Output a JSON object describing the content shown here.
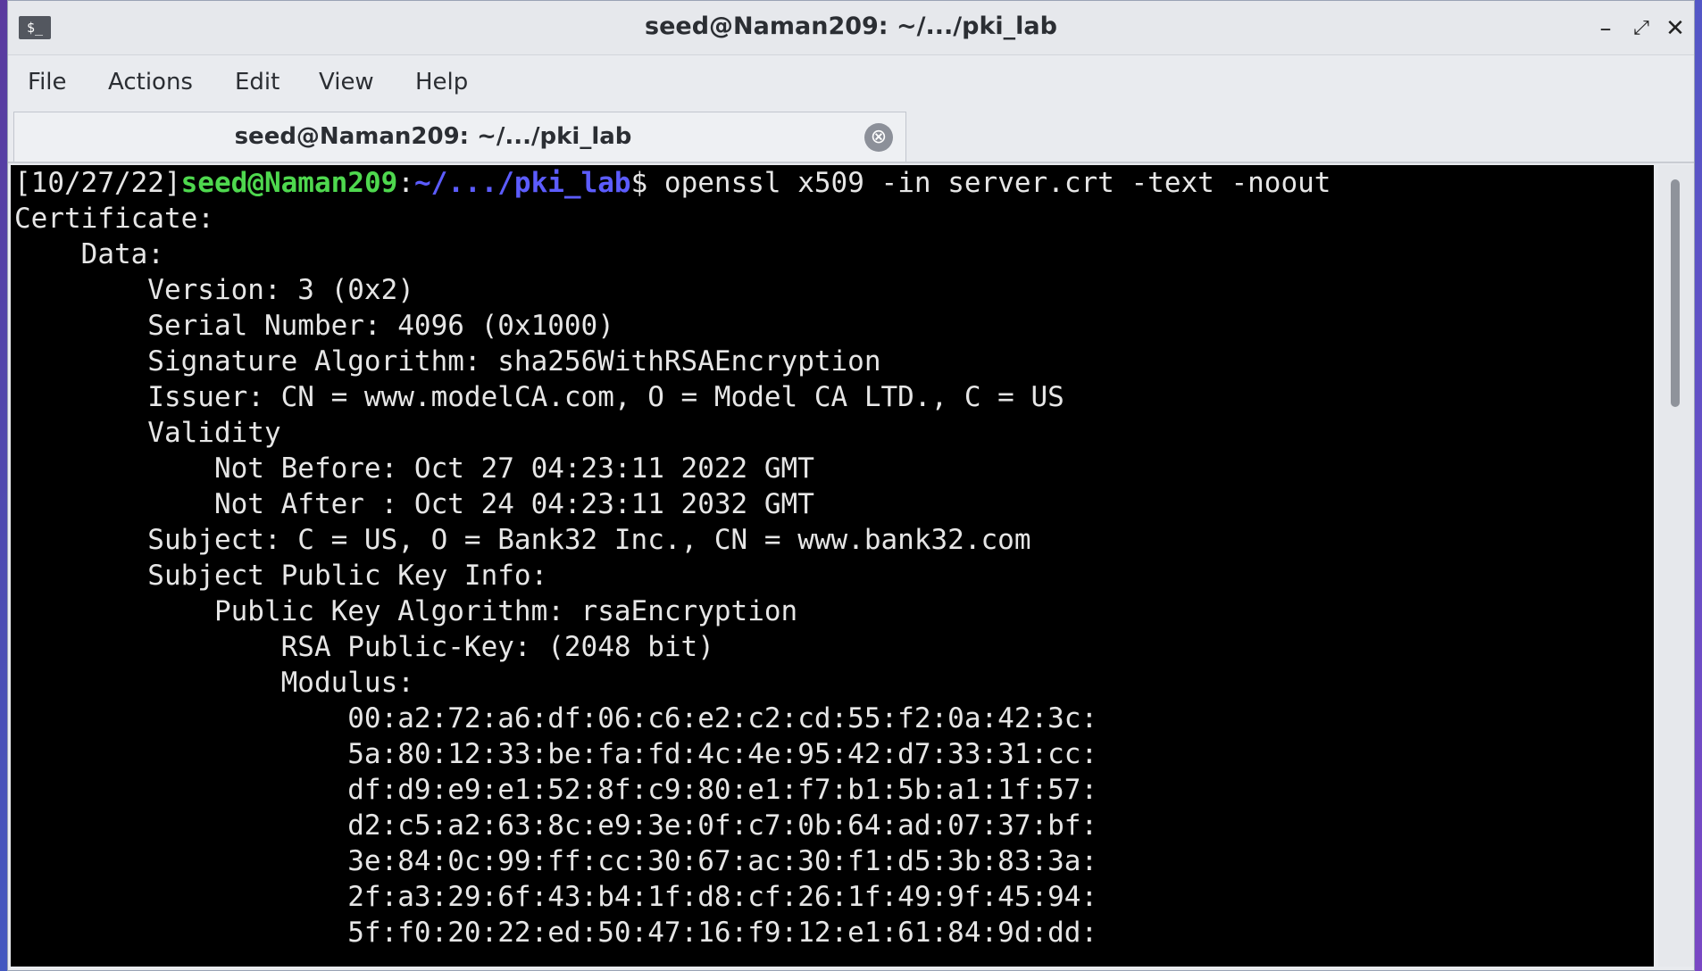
{
  "window": {
    "title": "seed@Naman209: ~/.../pki_lab",
    "icon_label": "$_",
    "controls": {
      "minimize": "–",
      "maximize": "⤢",
      "close": "✕"
    }
  },
  "menubar": {
    "items": [
      "File",
      "Actions",
      "Edit",
      "View",
      "Help"
    ]
  },
  "tabs": [
    {
      "label": "seed@Naman209: ~/.../pki_lab",
      "close_icon": "⊗"
    }
  ],
  "terminal": {
    "prompt": {
      "date": "[10/27/22]",
      "user_host": "seed@Naman209",
      "colon": ":",
      "path": "~/.../pki_lab",
      "symbol": "$ ",
      "command": "openssl x509 -in server.crt -text -noout"
    },
    "output_lines": [
      "Certificate:",
      "    Data:",
      "        Version: 3 (0x2)",
      "        Serial Number: 4096 (0x1000)",
      "        Signature Algorithm: sha256WithRSAEncryption",
      "        Issuer: CN = www.modelCA.com, O = Model CA LTD., C = US",
      "        Validity",
      "            Not Before: Oct 27 04:23:11 2022 GMT",
      "            Not After : Oct 24 04:23:11 2032 GMT",
      "        Subject: C = US, O = Bank32 Inc., CN = www.bank32.com",
      "        Subject Public Key Info:",
      "            Public Key Algorithm: rsaEncryption",
      "                RSA Public-Key: (2048 bit)",
      "                Modulus:",
      "                    00:a2:72:a6:df:06:c6:e2:c2:cd:55:f2:0a:42:3c:",
      "                    5a:80:12:33:be:fa:fd:4c:4e:95:42:d7:33:31:cc:",
      "                    df:d9:e9:e1:52:8f:c9:80:e1:f7:b1:5b:a1:1f:57:",
      "                    d2:c5:a2:63:8c:e9:3e:0f:c7:0b:64:ad:07:37:bf:",
      "                    3e:84:0c:99:ff:cc:30:67:ac:30:f1:d5:3b:83:3a:",
      "                    2f:a3:29:6f:43:b4:1f:d8:cf:26:1f:49:9f:45:94:",
      "                    5f:f0:20:22:ed:50:47:16:f9:12:e1:61:84:9d:dd:"
    ]
  },
  "colors": {
    "terminal_bg": "#000000",
    "terminal_fg": "#e6e6e6",
    "prompt_user": "#4ed84e",
    "prompt_path": "#5c5cff"
  }
}
